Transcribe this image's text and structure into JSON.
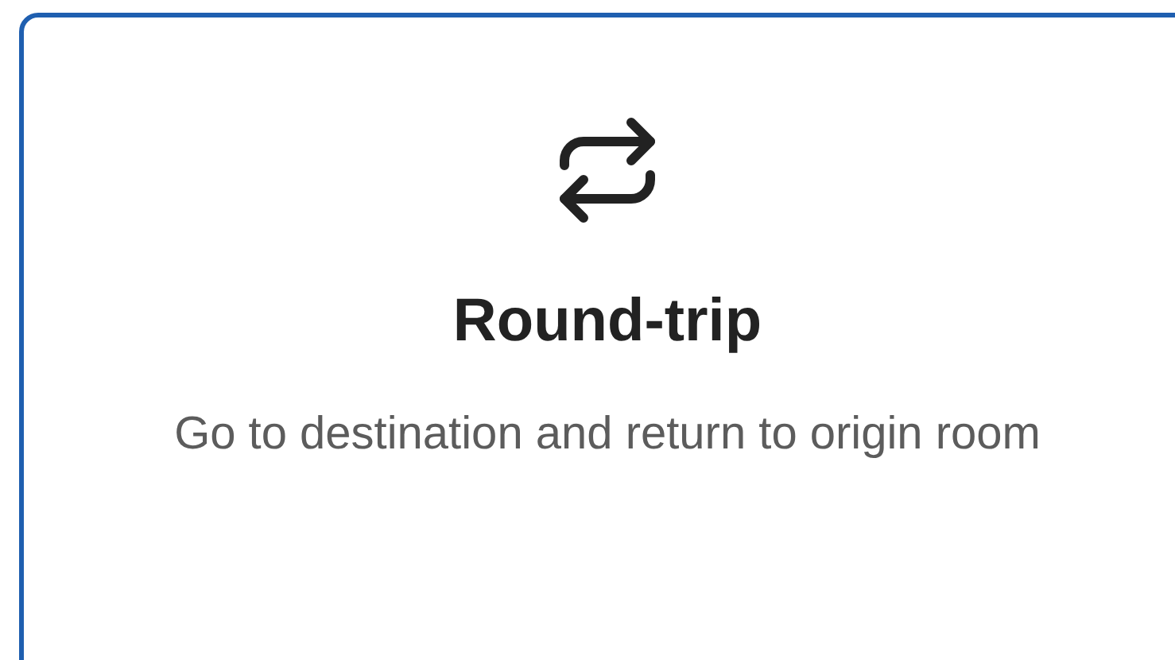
{
  "card": {
    "title": "Round-trip",
    "description": "Go to destination and return to origin room",
    "selected": true
  }
}
